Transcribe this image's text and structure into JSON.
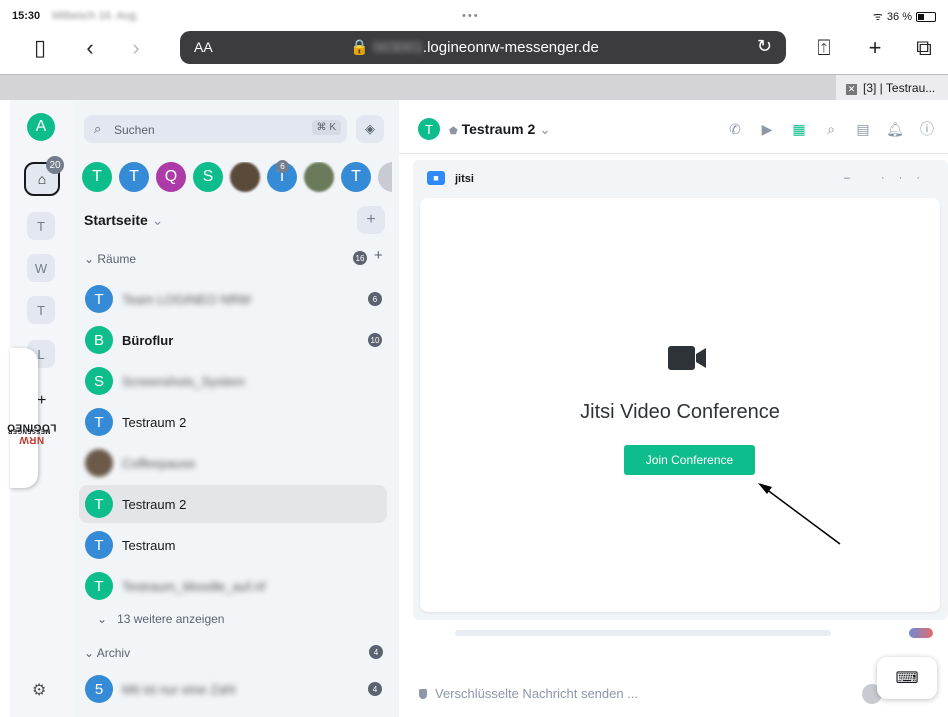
{
  "status": {
    "time": "15:30",
    "date": "Mittwoch 16. Aug.",
    "battery": "36 %"
  },
  "browser": {
    "aa": "AA",
    "url_prefix": "003001",
    "url_domain": ".logineonrw-messenger.de",
    "tab_label": "[3] | Testrau..."
  },
  "rail": {
    "account_initial": "A",
    "home_badge": "20",
    "spaces": [
      "T",
      "W",
      "T",
      "L"
    ],
    "logineo_a": "LOGINEO",
    "logineo_b": "NRW",
    "logineo_c": "MESSENGER"
  },
  "roomlist": {
    "search_placeholder": "Suchen",
    "search_shortcut": "⌘ K",
    "breadcrumbs": [
      {
        "initial": "T",
        "color": "#0dbd8b"
      },
      {
        "initial": "T",
        "color": "#368bd6"
      },
      {
        "initial": "Q",
        "color": "#ac3ba8"
      },
      {
        "initial": "S",
        "color": "#0dbd8b"
      },
      {
        "initial": "",
        "color": "#5a4a3a"
      },
      {
        "initial": "T",
        "color": "#368bd6",
        "badge": "6"
      },
      {
        "initial": "",
        "color": "#6a7a5a"
      },
      {
        "initial": "T",
        "color": "#368bd6"
      }
    ],
    "home_label": "Startseite",
    "rooms_label": "Räume",
    "rooms_count": "16",
    "rooms": [
      {
        "initial": "T",
        "color": "#368bd6",
        "name": "Team LOGINEO NRW",
        "blurred": true,
        "count": "6"
      },
      {
        "initial": "B",
        "color": "#0dbd8b",
        "name": "Büroflur",
        "bold": true,
        "count": "10"
      },
      {
        "initial": "S",
        "color": "#0dbd8b",
        "name": "Screenshots_System",
        "blurred": true
      },
      {
        "initial": "T",
        "color": "#368bd6",
        "name": "Testraum 2"
      },
      {
        "initial": "",
        "color": "#6b5a4a",
        "name": "Coffeepause",
        "blurred": true
      },
      {
        "initial": "T",
        "color": "#0dbd8b",
        "name": "Testraum 2",
        "selected": true
      },
      {
        "initial": "T",
        "color": "#368bd6",
        "name": "Testraum"
      },
      {
        "initial": "T",
        "color": "#0dbd8b",
        "name": "Testraum_Moodle_auf.nf",
        "blurred": true
      }
    ],
    "more_label": "13 weitere anzeigen",
    "archive_label": "Archiv",
    "archive_count": "4",
    "archive_rooms": [
      {
        "initial": "5",
        "color": "#368bd6",
        "name": "Mit ist nur eine Zahl",
        "blurred": true,
        "count": "4"
      }
    ]
  },
  "main": {
    "room_initial": "T",
    "room_title": "Testraum 2",
    "widget_title": "jitsi",
    "widget_controls": "– ···",
    "conference_title": "Jitsi Video Conference",
    "join_label": "Join Conference",
    "composer_placeholder": "Verschlüsselte Nachricht senden ..."
  },
  "colors": {
    "accent": "#0dbd8b",
    "blue": "#368bd6"
  }
}
